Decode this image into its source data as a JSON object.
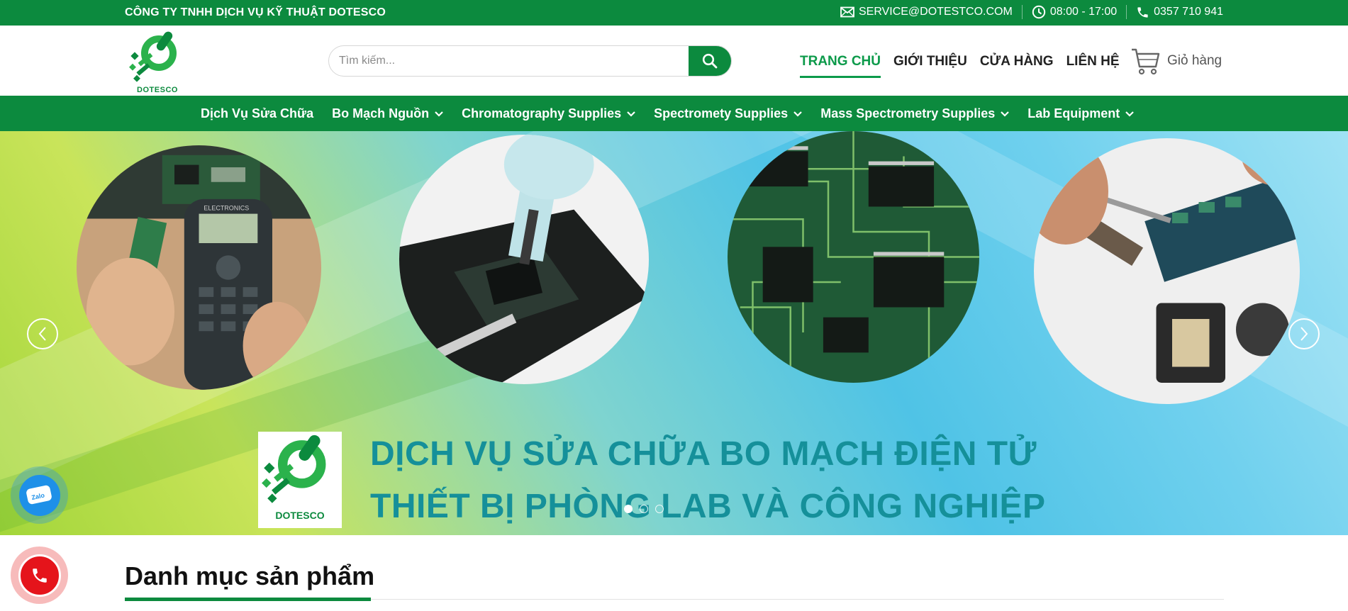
{
  "topbar": {
    "company": "CÔNG TY TNHH DỊCH VỤ KỸ THUẬT DOTESCO",
    "email": "SERVICE@DOTESTCO.COM",
    "hours": "08:00 - 17:00",
    "phone": "0357 710 941",
    "email_icon": "mail-icon",
    "hours_icon": "clock-icon",
    "phone_icon": "phone-icon"
  },
  "header": {
    "logo_text": "DOTESCO",
    "search_placeholder": "Tìm kiếm...",
    "nav": [
      {
        "label": "TRANG CHỦ",
        "active": true
      },
      {
        "label": "GIỚI THIỆU",
        "active": false
      },
      {
        "label": "CỬA HÀNG",
        "active": false
      },
      {
        "label": "LIÊN HỆ",
        "active": false
      }
    ],
    "cart_label": "Giỏ hàng"
  },
  "categories": [
    {
      "label": "Dịch Vụ Sửa Chữa",
      "dropdown": false
    },
    {
      "label": "Bo Mạch Nguồn",
      "dropdown": true
    },
    {
      "label": "Chromatography Supplies",
      "dropdown": true
    },
    {
      "label": "Spectromety Supplies",
      "dropdown": true
    },
    {
      "label": "Mass Spectrometry Supplies",
      "dropdown": true
    },
    {
      "label": "Lab Equipment",
      "dropdown": true
    }
  ],
  "hero": {
    "logo_text": "DOTESCO",
    "headline_1": "DỊCH VỤ SỬA CHỮA BO MẠCH ĐIỆN TỬ",
    "headline_2": "THIẾT BỊ PHÒNG LAB VÀ CÔNG NGHIỆP",
    "photo_device_label": "ELECTRONICS",
    "slides_count": 3,
    "active_slide": 1
  },
  "section": {
    "title": "Danh mục sản phẩm"
  },
  "floating": {
    "zalo_label": "Zalo"
  },
  "colors": {
    "brand_green": "#0c8a3e",
    "active_green": "#0c9a4a",
    "headline_teal": "#15909a",
    "call_red": "#e5141b"
  }
}
